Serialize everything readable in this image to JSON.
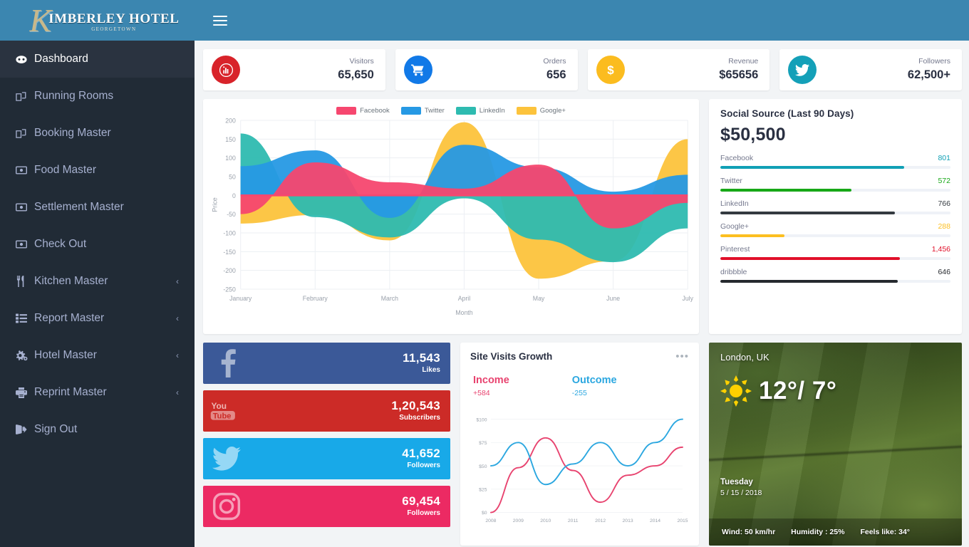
{
  "brand": {
    "initial": "K",
    "name": "IMBERLEY HOTEL",
    "sub": "GEORGETOWN"
  },
  "sidebar": {
    "items": [
      {
        "label": "Dashboard",
        "icon": "dashboard-icon",
        "active": true,
        "arrow": ""
      },
      {
        "label": "Running Rooms",
        "icon": "rooms-icon",
        "active": false,
        "arrow": ""
      },
      {
        "label": "Booking Master",
        "icon": "booking-icon",
        "active": false,
        "arrow": ""
      },
      {
        "label": "Food Master",
        "icon": "money-icon",
        "active": false,
        "arrow": ""
      },
      {
        "label": "Settlement Master",
        "icon": "money-icon",
        "active": false,
        "arrow": ""
      },
      {
        "label": "Check Out",
        "icon": "money-icon",
        "active": false,
        "arrow": ""
      },
      {
        "label": "Kitchen Master",
        "icon": "cutlery-icon",
        "active": false,
        "arrow": "‹"
      },
      {
        "label": "Report Master",
        "icon": "list-icon",
        "active": false,
        "arrow": "‹"
      },
      {
        "label": "Hotel Master",
        "icon": "gears-icon",
        "active": false,
        "arrow": "‹"
      },
      {
        "label": "Reprint Master",
        "icon": "printer-icon",
        "active": false,
        "arrow": "‹"
      },
      {
        "label": "Sign Out",
        "icon": "signout-icon",
        "active": false,
        "arrow": ""
      }
    ]
  },
  "topbar": {
    "menu_toggle": "hamburger-icon"
  },
  "stats": [
    {
      "title": "Visitors",
      "value": "65,650",
      "icon": "bar-chart-icon",
      "color": "#d8232a"
    },
    {
      "title": "Orders",
      "value": "656",
      "icon": "cart-icon",
      "color": "#1179e7"
    },
    {
      "title": "Revenue",
      "value": "$65656",
      "icon": "dollar-icon",
      "color": "#fbbc1f"
    },
    {
      "title": "Followers",
      "value": "62,500+",
      "icon": "twitter-icon",
      "color": "#14a0b8"
    }
  ],
  "chart_data": [
    {
      "type": "area",
      "id": "social-network-area",
      "title": "",
      "xlabel": "Month",
      "ylabel": "Price",
      "categories": [
        "January",
        "February",
        "March",
        "April",
        "May",
        "June",
        "July"
      ],
      "ylim": [
        -250,
        200
      ],
      "yticks": [
        200,
        150,
        100,
        50,
        0,
        -50,
        -100,
        -150,
        -200,
        -250
      ],
      "grid": true,
      "legend_position": "top-center",
      "series": [
        {
          "name": "Facebook",
          "color": "#f6476f",
          "values": [
            -50,
            88,
            35,
            18,
            82,
            -88,
            -20
          ]
        },
        {
          "name": "Twitter",
          "color": "#2699e4",
          "values": [
            78,
            120,
            -60,
            135,
            75,
            10,
            55
          ]
        },
        {
          "name": "LinkedIn",
          "color": "#2ebbb0",
          "values": [
            165,
            -58,
            -112,
            -8,
            -118,
            -178,
            -88
          ]
        },
        {
          "name": "Google+",
          "color": "#fcc33c",
          "values": [
            -75,
            -52,
            -120,
            195,
            -222,
            -175,
            150
          ]
        }
      ]
    },
    {
      "type": "line",
      "id": "site-visits-growth",
      "title": "Site Visits Growth",
      "xlabel": "",
      "ylabel": "",
      "categories": [
        "2008",
        "2009",
        "2010",
        "2011",
        "2012",
        "2013",
        "2014",
        "2015"
      ],
      "ylim": [
        0,
        100
      ],
      "yticks": [
        "$0",
        "$25",
        "$50",
        "$75",
        "$100"
      ],
      "grid": true,
      "series": [
        {
          "name": "Income",
          "color": "#e8436f",
          "delta": "+584",
          "values": [
            0,
            48,
            80,
            45,
            11,
            40,
            50,
            70
          ]
        },
        {
          "name": "Outcome",
          "color": "#2ba7e0",
          "delta": "-255",
          "values": [
            50,
            75,
            30,
            52,
            75,
            50,
            75,
            100
          ]
        }
      ]
    }
  ],
  "social_source": {
    "title": "Social Source (Last 90 Days)",
    "amount": "$50,500",
    "rows": [
      {
        "name": "Facebook",
        "value": "801",
        "color": "#10a0b5",
        "percent": 80
      },
      {
        "name": "Twitter",
        "value": "572",
        "color": "#17a817",
        "percent": 57
      },
      {
        "name": "LinkedIn",
        "value": "766",
        "color": "#343a40",
        "percent": 76
      },
      {
        "name": "Google+",
        "value": "288",
        "color": "#fcbf20",
        "percent": 28
      },
      {
        "name": "Pinterest",
        "value": "1,456",
        "color": "#e1102a",
        "percent": 78
      },
      {
        "name": "dribbble",
        "value": "646",
        "color": "#25292e",
        "percent": 77
      }
    ]
  },
  "social_tiles": [
    {
      "network": "facebook",
      "icon": "facebook-icon",
      "value": "11,543",
      "label": "Likes",
      "color": "#3b5998"
    },
    {
      "network": "youtube",
      "icon": "youtube-icon",
      "value": "1,20,543",
      "label": "Subscribers",
      "color": "#cc2b27"
    },
    {
      "network": "twitter",
      "icon": "twitter-icon",
      "value": "41,652",
      "label": "Followers",
      "color": "#18a9e8"
    },
    {
      "network": "instagram",
      "icon": "instagram-icon",
      "value": "69,454",
      "label": "Followers",
      "color": "#ec2a63"
    }
  ],
  "visits": {
    "menu": "•••"
  },
  "weather": {
    "city": "London, UK",
    "icon": "sun-icon",
    "temperature": "12°/ 7°",
    "day": "Tuesday",
    "date": "5 / 15 / 2018",
    "wind": "Wind: 50 km/hr",
    "humidity": "Humidity : 25%",
    "feels_like": "Feels like: 34°"
  }
}
